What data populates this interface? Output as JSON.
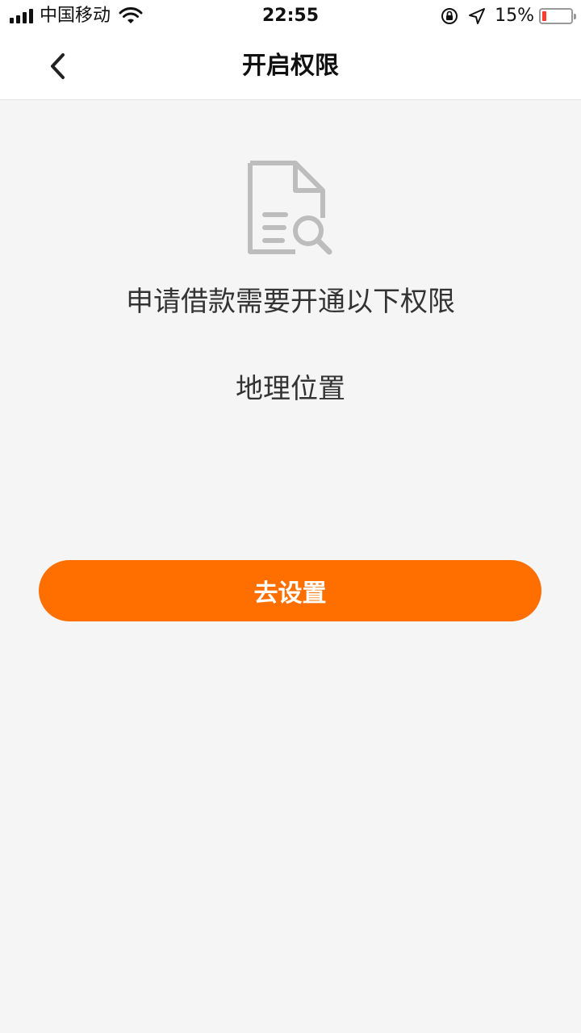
{
  "status_bar": {
    "carrier": "中国移动",
    "time": "22:55",
    "battery_percent": "15%",
    "battery_level": 0.15,
    "icons": [
      "signal-icon",
      "wifi-icon",
      "orientation-lock-icon",
      "location-icon",
      "battery-icon"
    ]
  },
  "nav": {
    "title": "开启权限",
    "back_icon": "chevron-left-icon"
  },
  "content": {
    "icon": "document-search-icon",
    "description": "申请借款需要开通以下权限",
    "permissions": [
      "地理位置"
    ]
  },
  "action": {
    "button_label": "去设置"
  },
  "colors": {
    "accent": "#ff6f00",
    "background": "#f5f5f5",
    "icon_gray": "#bdbdbd"
  }
}
